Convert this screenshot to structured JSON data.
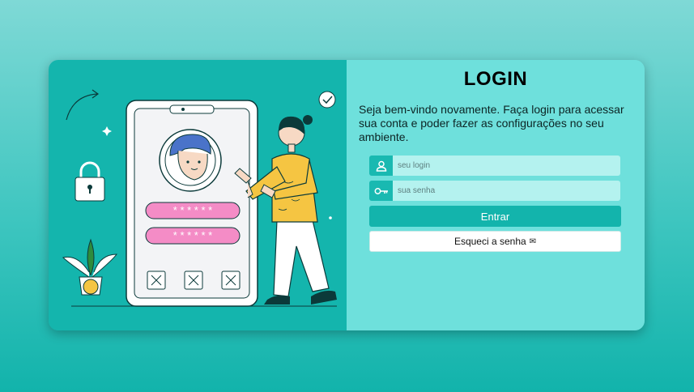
{
  "login": {
    "title": "LOGIN",
    "welcome_text": "Seja bem-vindo novamente. Faça login para acessar sua conta e poder fazer as configurações no seu ambiente.",
    "username_placeholder": "seu login",
    "password_placeholder": "sua senha",
    "enter_label": "Entrar",
    "forgot_label": "Esqueci a senha",
    "user_icon": "user-icon",
    "key_icon": "key-icon",
    "mail_icon": "mail-icon",
    "mail_glyph": "✉"
  },
  "illustration": {
    "password_mask": "* * * * * *"
  },
  "colors": {
    "left_panel": "#14b5ad",
    "right_panel": "#6ee0dc",
    "input_bg": "#b4f2ef",
    "accent": "#13b4ac",
    "password_pill": "#f48cc6"
  }
}
